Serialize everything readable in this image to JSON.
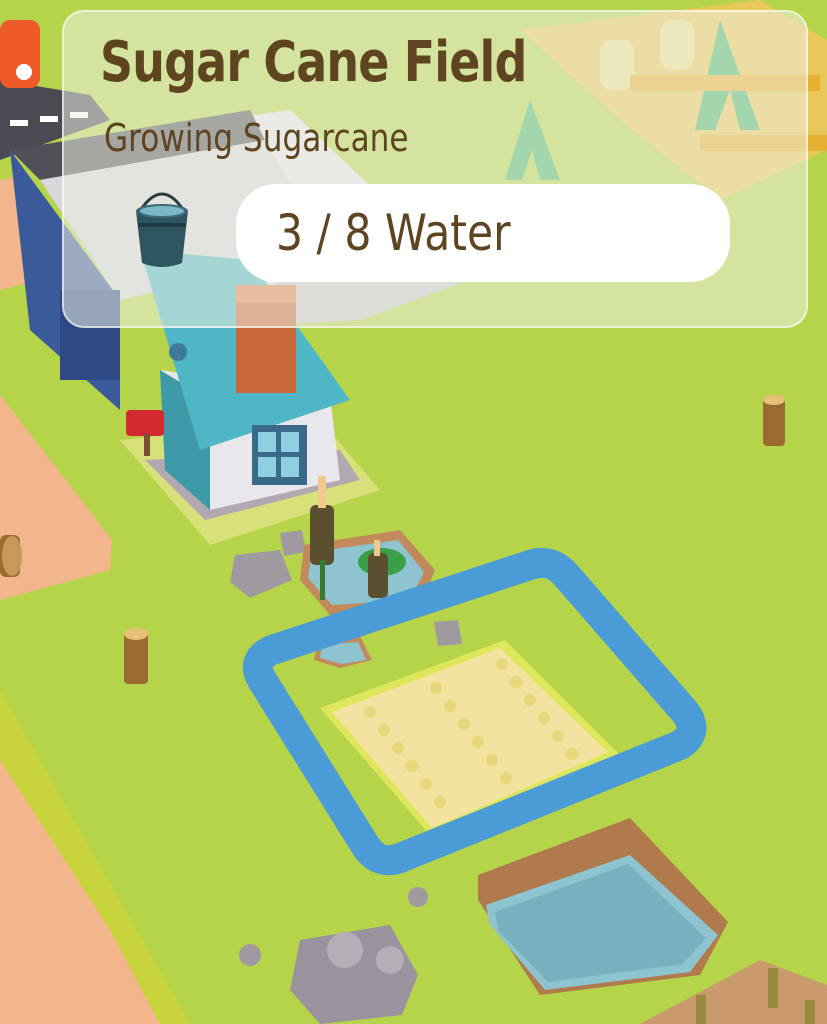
{
  "field_panel": {
    "title": "Sugar Cane Field",
    "subtitle": "Growing Sugarcane",
    "water": {
      "label": "3 / 8 Water",
      "current": 3,
      "required": 8
    }
  },
  "icons": {
    "bucket": "water-bucket-icon"
  },
  "colors": {
    "grass": "#b5d44a",
    "path": "#f2b58c",
    "selection": "#4a9bd6",
    "field": "#f4e3a0",
    "text": "#5e4420"
  }
}
